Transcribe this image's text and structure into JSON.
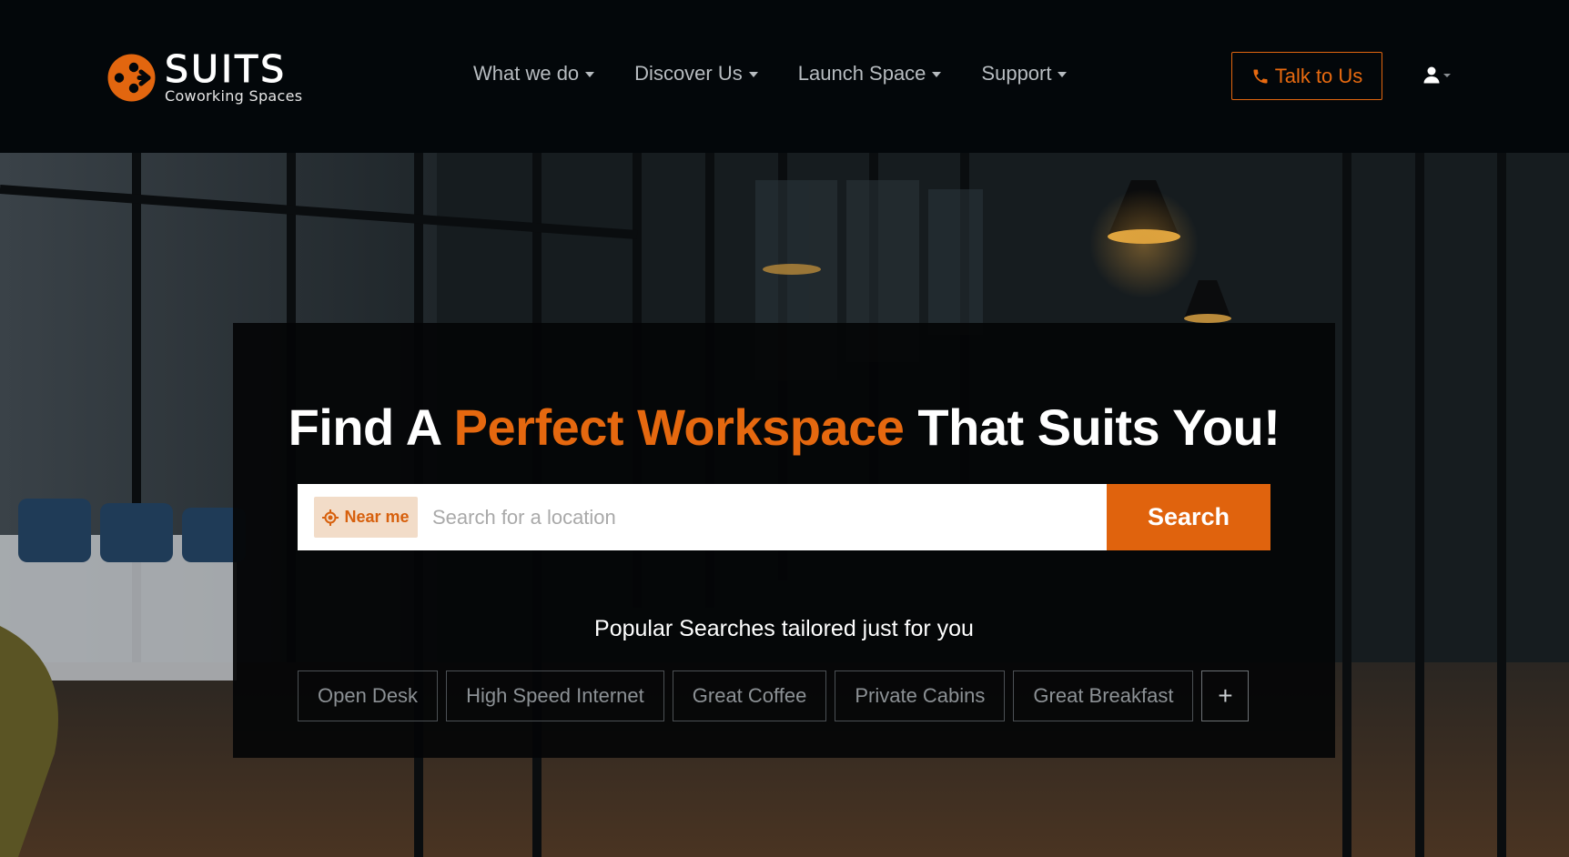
{
  "brand": {
    "name": "SUITS",
    "tagline": "Coworking Spaces",
    "accent_color": "#e2660f"
  },
  "nav": {
    "items": [
      {
        "label": "What we do"
      },
      {
        "label": "Discover Us"
      },
      {
        "label": "Launch Space"
      },
      {
        "label": "Support"
      }
    ],
    "cta_label": "Talk to Us",
    "cta_icon": "phone-icon",
    "user_icon": "user-icon"
  },
  "hero": {
    "headline_start": "Find A ",
    "headline_accent": "Perfect Workspace",
    "headline_end": " That Suits You!",
    "near_me_label": "Near me",
    "near_me_icon": "crosshair-icon",
    "search_placeholder": "Search for a location",
    "search_value": "",
    "search_button": "Search",
    "popular_title": "Popular Searches tailored just for you",
    "chips": [
      "Open Desk",
      "High Speed Internet",
      "Great Coffee",
      "Private Cabins",
      "Great Breakfast"
    ],
    "more_label": "+"
  }
}
